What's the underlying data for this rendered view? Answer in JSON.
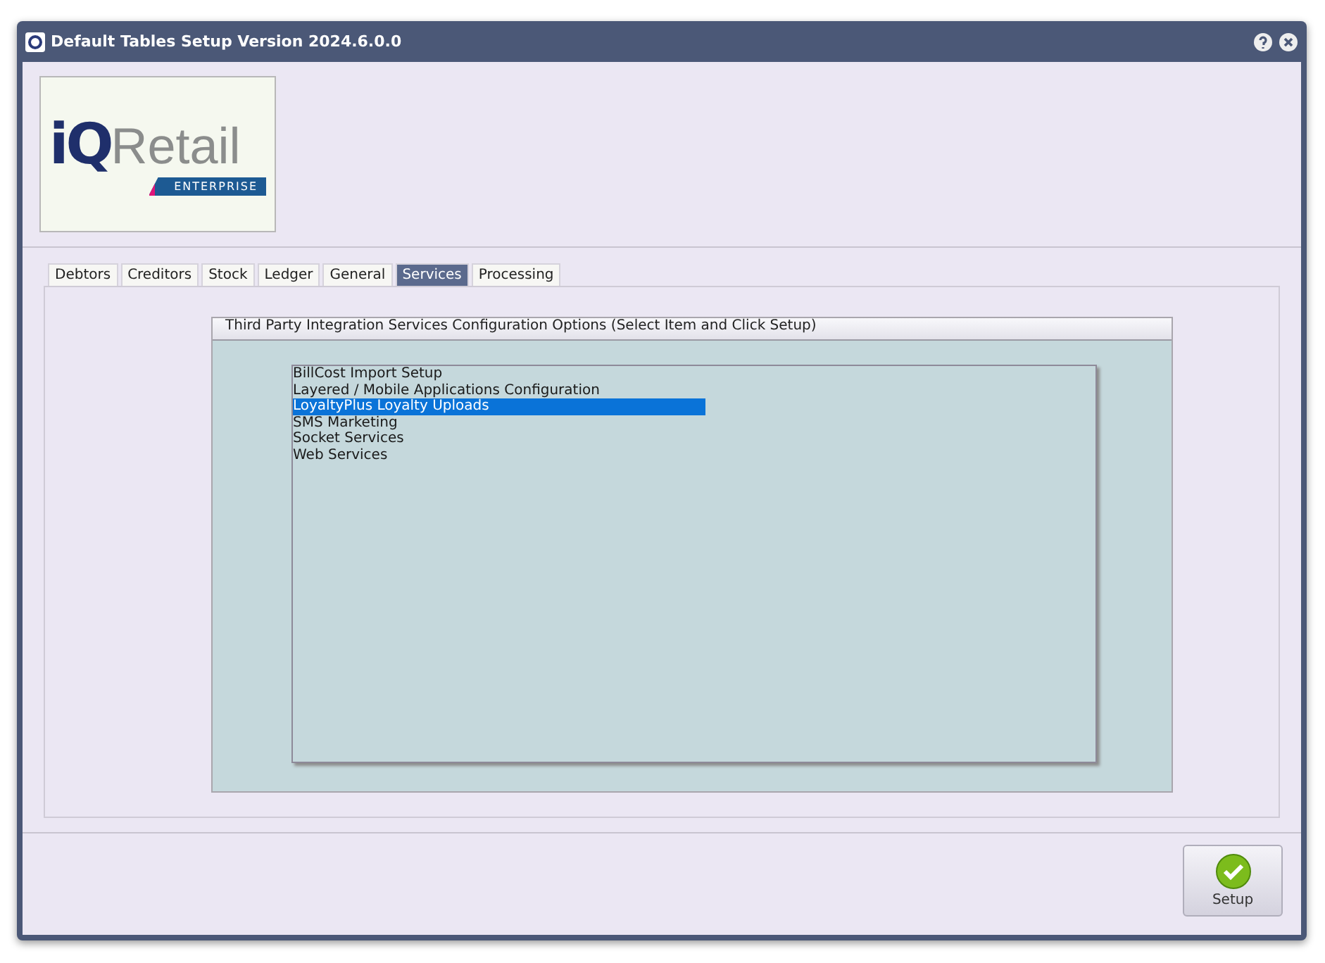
{
  "window": {
    "title": "Default Tables Setup Version 2024.6.0.0"
  },
  "logo": {
    "mark": "iQ",
    "name": "Retail",
    "edition": "ENTERPRISE"
  },
  "tabs": [
    {
      "label": "Debtors",
      "selected": false
    },
    {
      "label": "Creditors",
      "selected": false
    },
    {
      "label": "Stock",
      "selected": false
    },
    {
      "label": "Ledger",
      "selected": false
    },
    {
      "label": "General",
      "selected": false
    },
    {
      "label": "Services",
      "selected": true
    },
    {
      "label": "Processing",
      "selected": false
    }
  ],
  "group": {
    "title": "Third Party Integration Services Configuration Options (Select Item and Click Setup)"
  },
  "items": [
    {
      "label": "BillCost Import Setup",
      "selected": false
    },
    {
      "label": "Layered / Mobile Applications Configuration",
      "selected": false
    },
    {
      "label": "LoyaltyPlus Loyalty Uploads",
      "selected": true
    },
    {
      "label": "SMS Marketing",
      "selected": false
    },
    {
      "label": "Socket Services",
      "selected": false
    },
    {
      "label": "Web Services",
      "selected": false
    }
  ],
  "buttons": [
    {
      "label": "Setup"
    }
  ]
}
